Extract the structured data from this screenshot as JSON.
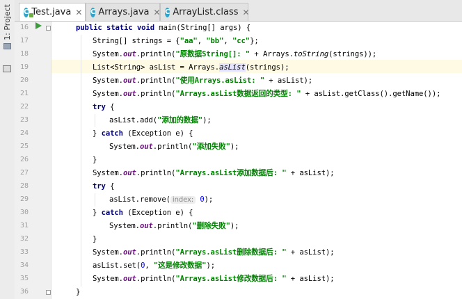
{
  "sidebar": {
    "project_label": "1: Project"
  },
  "tabs": [
    {
      "label": "Test.java",
      "icon": "C",
      "active": true
    },
    {
      "label": "Arrays.java",
      "icon": "C",
      "active": false
    },
    {
      "label": "ArrayList.class",
      "icon": "C",
      "active": false
    }
  ],
  "line_numbers": [
    "16",
    "17",
    "18",
    "19",
    "20",
    "21",
    "22",
    "23",
    "24",
    "25",
    "26",
    "27",
    "28",
    "29",
    "30",
    "31",
    "32",
    "33",
    "34",
    "35",
    "36"
  ],
  "code": {
    "l16": {
      "kw1": "public static void ",
      "rest": "main(String[] args) {"
    },
    "l17": {
      "a": "String[] strings = {",
      "s1": "\"aa\"",
      "c1": ", ",
      "s2": "\"bb\"",
      "c2": ", ",
      "s3": "\"cc\"",
      "end": "};"
    },
    "l18": {
      "a": "System.",
      "f": "out",
      "b": ".println(",
      "s": "\"原数据String[]: \"",
      "c": " + Arrays.",
      "m": "toString",
      "d": "(strings));"
    },
    "l19": {
      "a": "List<String> asList = Arrays.",
      "m": "asList",
      "b": "(strings);"
    },
    "l20": {
      "a": "System.",
      "f": "out",
      "b": ".println(",
      "s": "\"使用Arrays.asList: \"",
      "c": " + asList);"
    },
    "l21": {
      "a": "System.",
      "f": "out",
      "b": ".println(",
      "s": "\"Arrays.asList数据返回的类型: \"",
      "c": " + asList.getClass().getName());"
    },
    "l22": {
      "kw": "try",
      "b": " {"
    },
    "l23": {
      "a": "asList.add(",
      "s": "\"添加的数据\"",
      "b": ");"
    },
    "l24": {
      "a": "} ",
      "kw": "catch",
      "b": " (Exception e) {"
    },
    "l25": {
      "a": "System.",
      "f": "out",
      "b": ".println(",
      "s": "\"添加失败\"",
      "c": ");"
    },
    "l26": {
      "a": "}"
    },
    "l27": {
      "a": "System.",
      "f": "out",
      "b": ".println(",
      "s": "\"Arrays.asList添加数据后: \"",
      "c": " + asList);"
    },
    "l28": {
      "kw": "try",
      "b": " {"
    },
    "l29": {
      "a": "asList.remove(",
      "hint": "index:",
      "n": "0",
      "b": ");"
    },
    "l30": {
      "a": "} ",
      "kw": "catch",
      "b": " (Exception e) {"
    },
    "l31": {
      "a": "System.",
      "f": "out",
      "b": ".println(",
      "s": "\"删除失败\"",
      "c": ");"
    },
    "l32": {
      "a": "}"
    },
    "l33": {
      "a": "System.",
      "f": "out",
      "b": ".println(",
      "s": "\"Arrays.asList删除数据后: \"",
      "c": " + asList);"
    },
    "l34": {
      "a": "asList.set(",
      "n": "0",
      "c": ", ",
      "s": "\"这是修改数据\"",
      "b": ");"
    },
    "l35": {
      "a": "System.",
      "f": "out",
      "b": ".println(",
      "s": "\"Arrays.asList修改数据后: \"",
      "c": " + asList);"
    },
    "l36": {
      "a": "}"
    }
  }
}
